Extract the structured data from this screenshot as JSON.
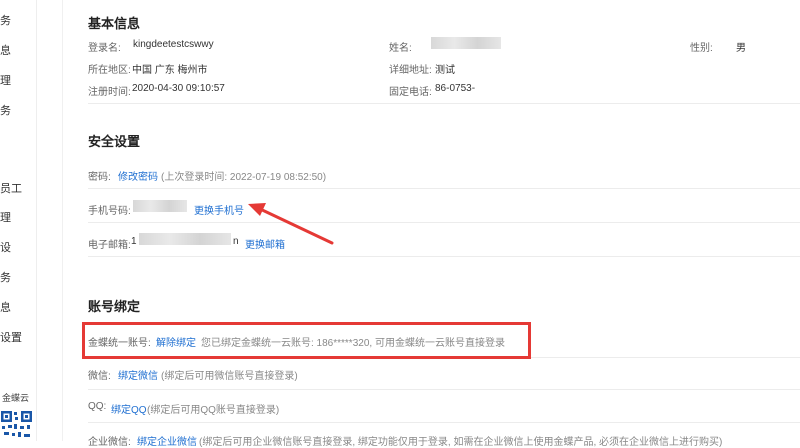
{
  "sidebar": {
    "items": [
      "务",
      "息",
      "理",
      "务",
      "员工",
      "理",
      "设",
      "务",
      "息",
      "设置"
    ],
    "brand": "金蝶云"
  },
  "basic_info": {
    "title": "基本信息",
    "login_label": "登录名:",
    "login_value": "kingdeetestcswwy",
    "name_label": "姓名:",
    "gender_label": "性别:",
    "gender_value": "男",
    "region_label": "所在地区:",
    "region_value": "中国 广东 梅州市",
    "address_label": "详细地址:",
    "address_value": "测试",
    "register_label": "注册时间:",
    "register_value": "2020-04-30 09:10:57",
    "phone_label": "固定电话:",
    "phone_value": "86-0753-"
  },
  "security": {
    "title": "安全设置",
    "password_label": "密码:",
    "password_link": "修改密码",
    "password_hint": "(上次登录时间: 2022-07-19 08:52:50)",
    "mobile_label": "手机号码:",
    "mobile_link": "更换手机号",
    "email_label": "电子邮箱:",
    "email_prefix": "1",
    "email_suffix": "n",
    "email_link": "更换邮箱"
  },
  "binding": {
    "title": "账号绑定",
    "kingdee_label": "金蝶统一账号:",
    "kingdee_link": "解除绑定",
    "kingdee_hint": "您已绑定金蝶统一云账号: 186*****320, 可用金蝶统一云账号直接登录",
    "wechat_label": "微信:",
    "wechat_link": "绑定微信",
    "wechat_hint": "(绑定后可用微信账号直接登录)",
    "qq_label": "QQ:",
    "qq_link": "绑定QQ",
    "qq_hint": "(绑定后可用QQ账号直接登录)",
    "wecom_label": "企业微信:",
    "wecom_link": "绑定企业微信",
    "wecom_hint": "(绑定后可用企业微信账号直接登录, 绑定功能仅用于登录, 如需在企业微信上使用金蝶产品, 必须在企业微信上进行购买)"
  },
  "colors": {
    "link": "#1f6fd1",
    "annotation": "#e53935"
  }
}
